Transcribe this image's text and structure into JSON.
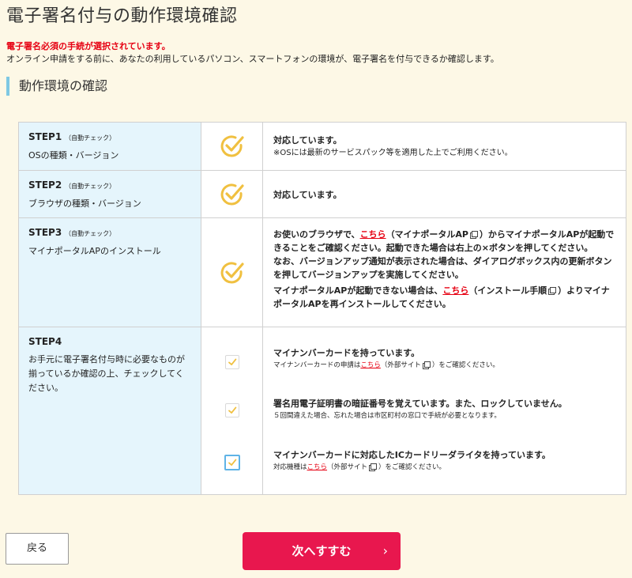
{
  "page": {
    "title": "電子署名付与の動作環境確認",
    "warning": "電子署名必須の手続が選択されています。",
    "description": "オンライン申請をする前に、あなたの利用しているパソコン、スマートフォンの環境が、電子署名を付与できるか確認します。",
    "section_heading": "動作環境の確認"
  },
  "colors": {
    "background": "#fdf8e6",
    "step_cell": "#e5f5fc",
    "check_gold": "#f0c040",
    "link_red": "#e60012",
    "primary_button": "#e8174e"
  },
  "steps": [
    {
      "label": "STEP1",
      "sub": "（自動チェック）",
      "name": "OSの種類・バージョン",
      "status_icon": "circle-check-icon",
      "message": "対応しています。",
      "note": "※OSには最新のサービスパック等を適用した上でご利用ください。"
    },
    {
      "label": "STEP2",
      "sub": "（自動チェック）",
      "name": "ブラウザの種類・バージョン",
      "status_icon": "circle-check-icon",
      "message": "対応しています。"
    },
    {
      "label": "STEP3",
      "sub": "（自動チェック）",
      "name": "マイナポータルAPのインストール",
      "status_icon": "circle-check-icon",
      "p1_a": "お使いのブラウザで、",
      "p1_link": "こちら",
      "p1_b": "（マイナポータルAP",
      "p1_c": "）からマイナポータルAPが起動できることをご確認ください。起動できた場合は右上の×ボタンを押してください。",
      "p2": "なお、バージョンアップ通知が表示された場合は、ダイアログボックス内の更新ボタンを押してバージョンアップを実施してください。",
      "p3_a": "マイナポータルAPが起動できない場合は、",
      "p3_link": "こちら",
      "p3_b": "（インストール手順",
      "p3_c": "）よりマイナポータルAPを再インストールしてください。"
    },
    {
      "label": "STEP4",
      "description": "お手元に電子署名付与時に必要なものが揃っているか確認の上、チェックしてください。",
      "items": [
        {
          "title": "マイナンバーカードを持っています。",
          "note_a": "マイナンバーカードの申請は",
          "note_link": "こちら",
          "note_b": "（外部サイト",
          "note_c": "）をご確認ください。",
          "checked": true
        },
        {
          "title": "署名用電子証明書の暗証番号を覚えています。また、ロックしていません。",
          "note": "５回間違えた場合、忘れた場合は市区町村の窓口で手続が必要となります。",
          "checked": true
        },
        {
          "title": "マイナンバーカードに対応したICカードリーダライタを持っています。",
          "note_a": "対応機種は",
          "note_link": "こちら",
          "note_b": "（外部サイト",
          "note_c": "）をご確認ください。",
          "checked": true
        }
      ]
    }
  ],
  "buttons": {
    "back": "戻る",
    "next": "次へすすむ",
    "next_chevron": "›"
  }
}
